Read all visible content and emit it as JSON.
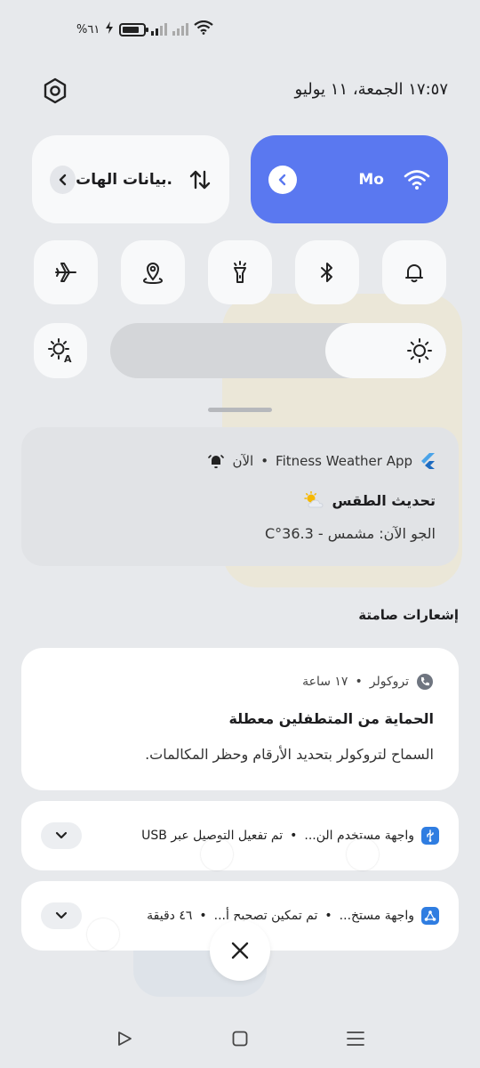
{
  "status_bar": {
    "battery_text": "%٦١"
  },
  "header": {
    "datetime": "١٧:٥٧  الجمعة، ١١ يوليو"
  },
  "tiles": {
    "wifi_label": "Mo",
    "mobile_data_label": "بيانات الهات."
  },
  "toggles": [
    "airplane-icon",
    "location-icon",
    "flashlight-icon",
    "bluetooth-icon",
    "bell-icon"
  ],
  "brightness": {
    "level_fraction": 0.36
  },
  "weather_notification": {
    "app_name": "Fitness Weather App",
    "time": "الآن",
    "title": "تحديث الطقس",
    "body": "الجو الآن: مشمس - 36.3°C"
  },
  "silent_section_label": "إشعارات صامتة",
  "truecaller_notification": {
    "app_name": "تروكولر",
    "time": "١٧ ساعة",
    "title": "الحماية من المتطفلين معطلة",
    "body": "السماح لتروكولر بتحديد الأرقام وحظر المكالمات."
  },
  "usb_notification": {
    "app_name": "واجهة مستخدم الن...",
    "text": "تم تفعيل التوصيل عبر USB"
  },
  "developer_notification": {
    "app_name": "واجهة مستخ...",
    "text": "تم تمكين تصحيح أ...",
    "time": "٤٦ دقيقة"
  },
  "colors": {
    "accent": "#5a78f0",
    "background": "#e7e9ec",
    "card": "#ffffff"
  }
}
